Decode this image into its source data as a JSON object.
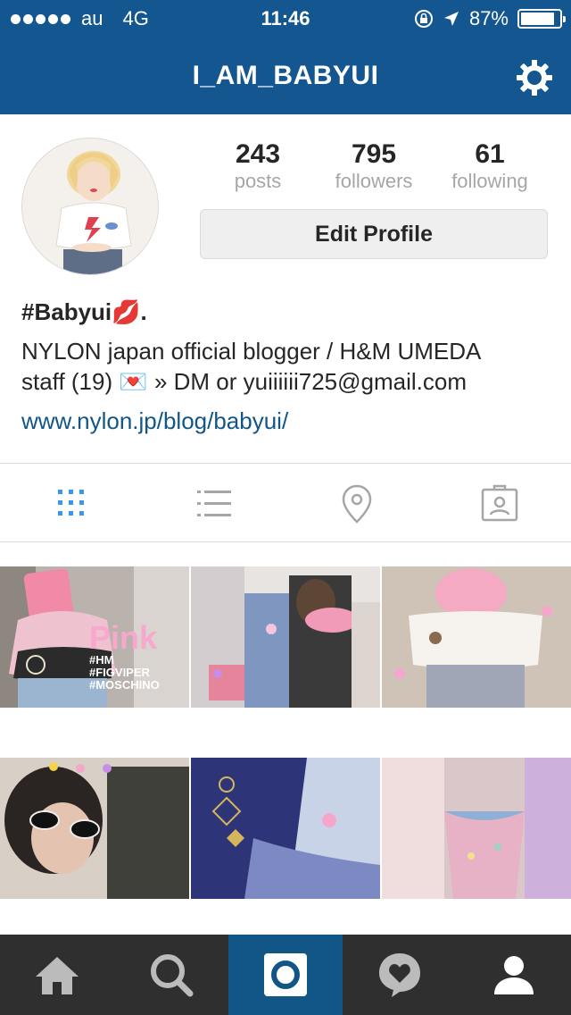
{
  "status_bar": {
    "carrier": "au",
    "network": "4G",
    "time": "11:46",
    "battery": "87%",
    "battery_level": 0.87
  },
  "nav": {
    "title": "I_AM_BABYUI",
    "settings_icon": "gear-icon"
  },
  "profile": {
    "stats": [
      {
        "value": "243",
        "label": "posts"
      },
      {
        "value": "795",
        "label": "followers"
      },
      {
        "value": "61",
        "label": "following"
      }
    ],
    "edit_label": "Edit Profile",
    "name": "#Babyui💋.",
    "bio_line1": "NYLON japan official blogger / H&M UMEDA",
    "bio_line2": "staff (19) 💌 » DM or yuiiiiii725@gmail.com",
    "website": "www.nylon.jp/blog/babyui/"
  },
  "tabs": [
    {
      "icon": "grid-icon",
      "active": true
    },
    {
      "icon": "list-icon",
      "active": false
    },
    {
      "icon": "location-pin-icon",
      "active": false
    },
    {
      "icon": "tagged-photos-icon",
      "active": false
    }
  ],
  "grid": {
    "tile1_text": {
      "big": "Pink",
      "tags": [
        "#HM",
        "#FIGVIPER",
        "#MOSCHINO"
      ]
    }
  },
  "bottom_nav": [
    {
      "icon": "home-icon",
      "active": false
    },
    {
      "icon": "search-icon",
      "active": false
    },
    {
      "icon": "camera-icon",
      "active": true
    },
    {
      "icon": "activity-heart-icon",
      "active": false
    },
    {
      "icon": "profile-icon",
      "active": false
    }
  ],
  "colors": {
    "brand_blue": "#135690",
    "link_blue": "#125688",
    "tab_active": "#3897f0",
    "tab_inactive": "#a6a6a6",
    "bottom_bar": "#2f2f2f"
  }
}
